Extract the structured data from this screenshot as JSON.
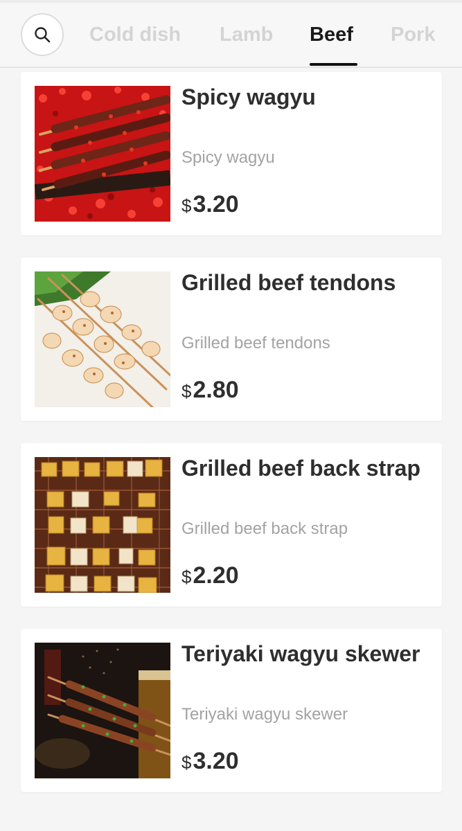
{
  "header": {
    "search_icon": "search-icon",
    "tabs": [
      {
        "label": "Cold dish",
        "active": false
      },
      {
        "label": "Lamb",
        "active": false
      },
      {
        "label": "Beef",
        "active": true
      },
      {
        "label": "Pork",
        "active": false
      }
    ]
  },
  "menu": {
    "items": [
      {
        "title": "Spicy wagyu",
        "description": "Spicy wagyu",
        "currency": "$",
        "price": "3.20"
      },
      {
        "title": "Grilled beef tendons",
        "description": "Grilled beef tendons",
        "currency": "$",
        "price": "2.80"
      },
      {
        "title": "Grilled beef back strap",
        "description": "Grilled beef back strap",
        "currency": "$",
        "price": "2.20"
      },
      {
        "title": "Teriyaki wagyu skewer",
        "description": "Teriyaki wagyu skewer",
        "currency": "$",
        "price": "3.20"
      }
    ]
  },
  "colors": {
    "active_tab": "#1a1a1a",
    "inactive_tab": "#d4d4d4",
    "title_text": "#2e2e2e",
    "description_text": "#a3a3a3",
    "background": "#f5f5f5"
  }
}
